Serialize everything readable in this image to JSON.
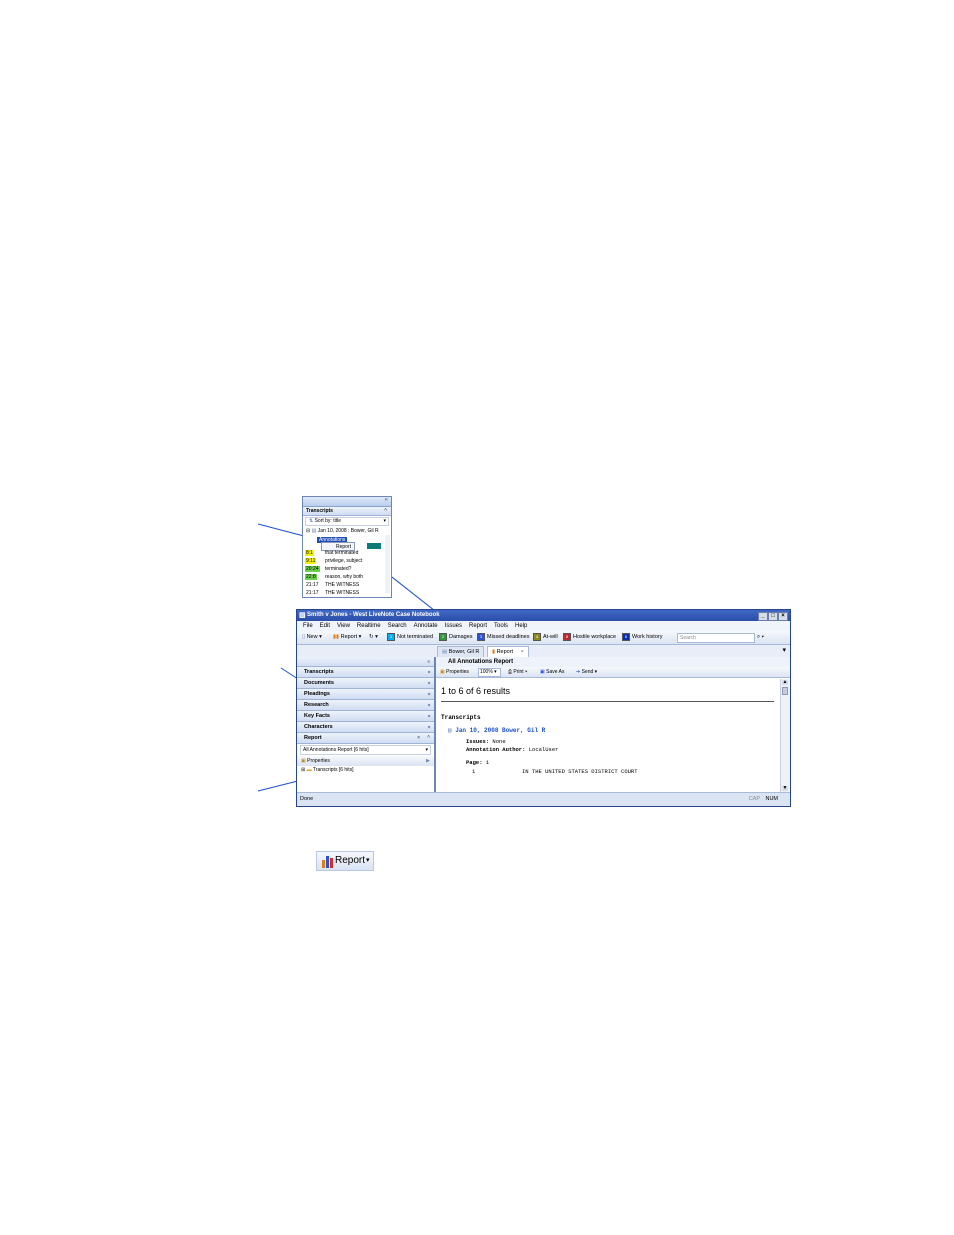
{
  "inset": {
    "section_title": "Transcripts",
    "sort_label": "Sort by: title",
    "transcript": "Jan 10, 2008 : Bower, Gil R",
    "selected_item": "Annotations",
    "popup_item": "Report",
    "rows": [
      {
        "tag": "8:1",
        "text": "that terminated",
        "color": "#f3f000"
      },
      {
        "tag": "9:11",
        "text": "privilege, subject",
        "color": "#f3f000"
      },
      {
        "tag": "20:24",
        "text": "terminated? ",
        "color": "#6cd14b"
      },
      {
        "tag": "22:8",
        "text": "reason, why both",
        "color": "#6cd14b"
      },
      {
        "tag": "21:17",
        "text": "THE WITNESS",
        "color": "#ffffff"
      },
      {
        "tag": "21:17",
        "text": "THE WITNESS",
        "color": "#ffffff"
      }
    ]
  },
  "window": {
    "title": "Smith v Jones - West LiveNote Case Notebook",
    "menu": [
      "File",
      "Edit",
      "View",
      "Realtime",
      "Search",
      "Annotate",
      "Issues",
      "Report",
      "Tools",
      "Help"
    ],
    "toolbar": {
      "new_label": "New",
      "report_label": "Report",
      "issues": [
        {
          "key": "1",
          "label": "Not terminated",
          "color": "#00b0f0"
        },
        {
          "key": "2",
          "label": "Damages",
          "color": "#2e9a3a"
        },
        {
          "key": "3",
          "label": "Missed deadlines",
          "color": "#2b51d6"
        },
        {
          "key": "4",
          "label": "At-will",
          "color": "#8a8a1a"
        },
        {
          "key": "5",
          "label": "Hostile workplace",
          "color": "#c0282d"
        },
        {
          "key": "6",
          "label": "Work history",
          "color": "#0a2fb5"
        }
      ],
      "search_placeholder": "Search"
    },
    "tabs": [
      {
        "label": "Bower, Gil R"
      },
      {
        "label": "Report"
      }
    ],
    "left_sections": [
      "Transcripts",
      "Documents",
      "Pleadings",
      "Research",
      "Key Facts",
      "Characters"
    ],
    "report_section": {
      "title": "Report",
      "selected_report": "All Annotations Report [6 hits]",
      "properties_label": "Properties",
      "tree_item": "Transcripts [6 hits]"
    },
    "right": {
      "header": "All Annotations Report",
      "properties_label": "Properties",
      "zoom": "100%",
      "print_label": "Print",
      "save_label": "Save As",
      "send_label": "Send",
      "results": "1 to 6 of 6 results",
      "section": "Transcripts",
      "link": "Jan 10, 2008 Bower, Gil R",
      "issues_label": "Issues:",
      "issues_value": "None",
      "author_label": "Annotation Author:",
      "author_value": "LocalUser",
      "page_label": "Page:",
      "page_value": "1",
      "line_no": "1",
      "line_text": "IN THE UNITED STATES DISTRICT COURT"
    },
    "status": {
      "left": "Done",
      "cap": "CAP",
      "num": "NUM"
    }
  },
  "bottom_button": {
    "label": "Report"
  }
}
